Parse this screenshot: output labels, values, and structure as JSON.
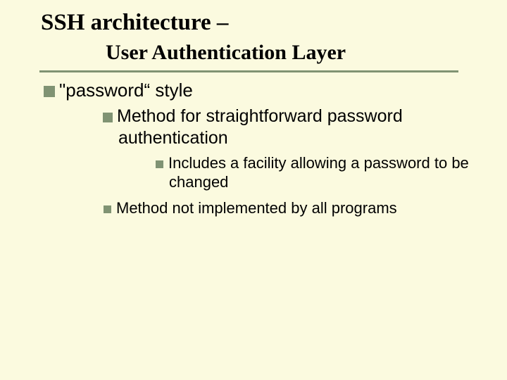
{
  "title": {
    "line1": "SSH architecture –",
    "line2": "User Authentication Layer"
  },
  "bullets": {
    "lvl1_1": "\"password“ style",
    "lvl2_1": "Method for straightforward password authentication",
    "lvl3_1": "Includes a facility allowing a password to be changed",
    "lvl3_2": "Method not implemented by all programs"
  },
  "icons": {
    "square": "square-bullet-icon"
  }
}
